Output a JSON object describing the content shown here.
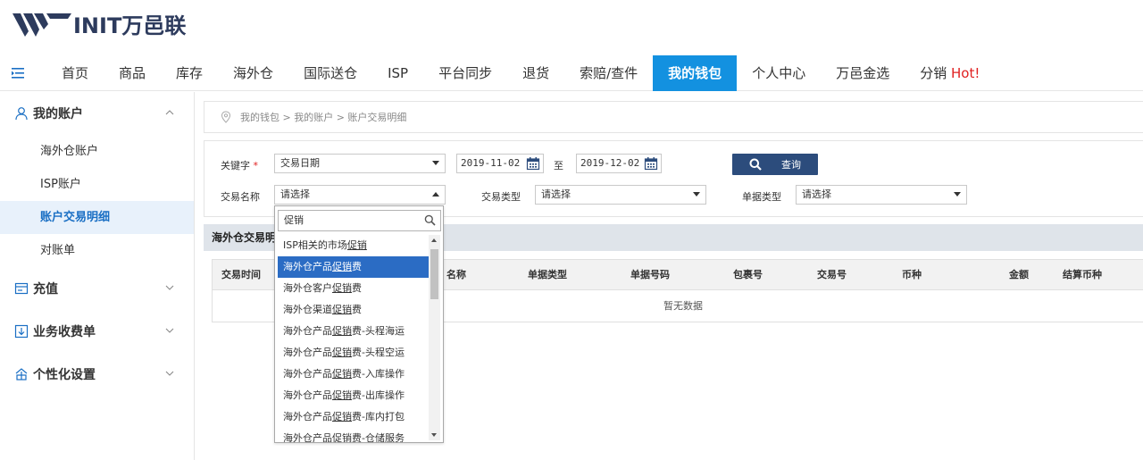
{
  "header": {
    "logo_text": "INIT万邑联"
  },
  "nav": {
    "items": [
      "首页",
      "商品",
      "库存",
      "海外仓",
      "国际送仓",
      "ISP",
      "平台同步",
      "退货",
      "索赔/查件",
      "我的钱包",
      "个人中心",
      "万邑金选",
      "分销"
    ],
    "active_index": 9,
    "hot_label": "Hot!"
  },
  "sidebar": {
    "groups": [
      {
        "label": "我的账户",
        "expanded": true,
        "icon": "user-icon",
        "items": [
          "海外仓账户",
          "ISP账户",
          "账户交易明细",
          "对账单"
        ],
        "active_item": 2
      },
      {
        "label": "充值",
        "expanded": false,
        "icon": "recharge-icon"
      },
      {
        "label": "业务收费单",
        "expanded": false,
        "icon": "bill-icon"
      },
      {
        "label": "个性化设置",
        "expanded": false,
        "icon": "settings-icon"
      }
    ]
  },
  "breadcrumb": {
    "text": "我的钱包 > 我的账户 > 账户交易明细"
  },
  "filter": {
    "keyword_label": "关键字",
    "keyword_required": "*",
    "keyword_value": "交易日期",
    "date_from": "2019-11-02",
    "date_to_label": "至",
    "date_to": "2019-12-02",
    "query_button": "查询",
    "trade_name_label": "交易名称",
    "trade_name_value": "请选择",
    "trade_type_label": "交易类型",
    "trade_type_value": "请选择",
    "doc_type_label": "单据类型",
    "doc_type_value": "请选择"
  },
  "section": {
    "title": "海外仓交易明"
  },
  "table": {
    "headers": [
      "交易时间",
      "名称",
      "单据类型",
      "单据号码",
      "包裹号",
      "交易号",
      "币种",
      "金额",
      "结算币种"
    ],
    "empty_text": "暂无数据"
  },
  "dropdown": {
    "search_value": "促销",
    "highlight_index": 1,
    "options": [
      "ISP相关的市场促销",
      "海外仓产品促销费",
      "海外仓客户促销费",
      "海外仓渠道促销费",
      "海外仓产品促销费-头程海运",
      "海外仓产品促销费-头程空运",
      "海外仓产品促销费-入库操作",
      "海外仓产品促销费-出库操作",
      "海外仓产品促销费-库内打包",
      "海外仓产品促销费-仓储服务"
    ]
  },
  "colors": {
    "nav_active": "#1391e0",
    "query_button": "#2c4c7c",
    "highlight": "#2b6cc4",
    "hot": "#e02020"
  }
}
